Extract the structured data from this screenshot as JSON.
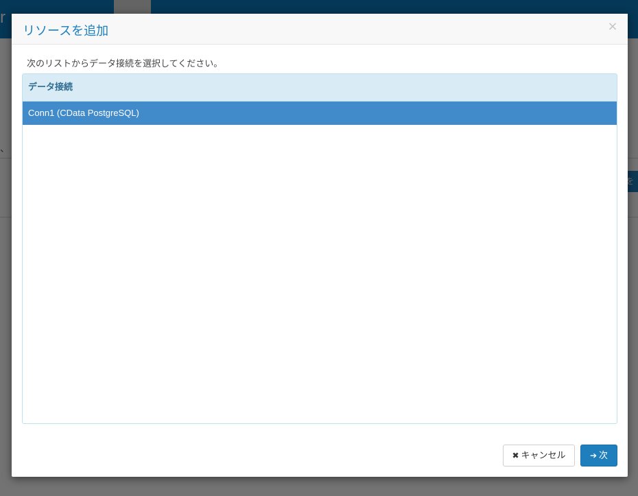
{
  "background": {
    "logo_char": "r",
    "small_text": "、",
    "right_button_label": "を"
  },
  "modal": {
    "title": "リソースを追加",
    "close_symbol": "×",
    "instruction": "次のリストからデータ接続を選択してください。",
    "list": {
      "header": "データ接続",
      "items": [
        {
          "label": "Conn1 (CData PostgreSQL)",
          "selected": true
        }
      ]
    },
    "buttons": {
      "cancel": {
        "icon": "close-icon",
        "glyph": "✖",
        "label": "キャンセル"
      },
      "next": {
        "icon": "arrow-right-icon",
        "glyph": "➔",
        "label": "次"
      }
    }
  },
  "colors": {
    "accent": "#1f7fbd",
    "selected_row": "#428bca",
    "header_bg": "#d9ecf6",
    "title": "#1a7fbf"
  }
}
